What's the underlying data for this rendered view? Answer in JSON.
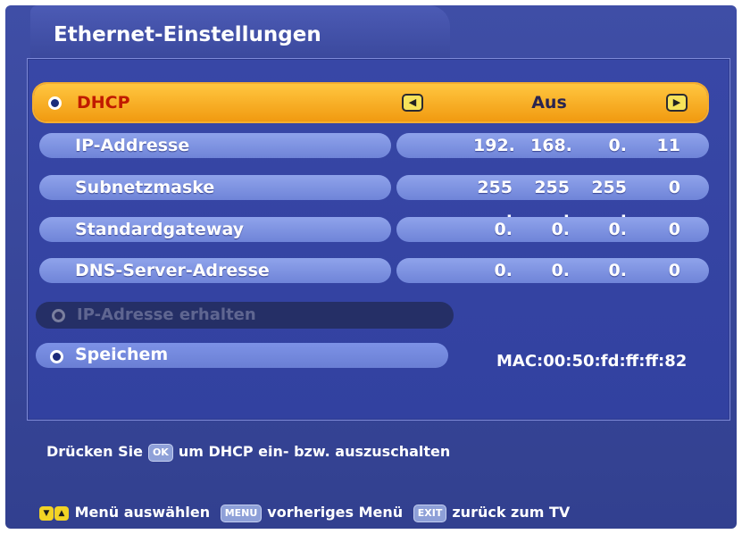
{
  "window": {
    "title": "Ethernet-Einstellungen"
  },
  "dhcp": {
    "label": "DHCP",
    "value": "Aus",
    "left_arrow_icon": "left-arrow-icon",
    "right_arrow_icon": "right-arrow-icon"
  },
  "rows": [
    {
      "label": "IP-Addresse",
      "octets": [
        "192.",
        "168.",
        "0.",
        "11"
      ]
    },
    {
      "label": "Subnetzmaske",
      "octets": [
        "255 .",
        "255 .",
        "255 .",
        "0"
      ]
    },
    {
      "label": "Standardgateway",
      "octets": [
        "0.",
        "0.",
        "0.",
        "0"
      ]
    },
    {
      "label": "DNS-Server-Adresse",
      "octets": [
        "0.",
        "0.",
        "0.",
        "0"
      ]
    }
  ],
  "actions": {
    "obtain_ip_label": "IP-Adresse erhalten",
    "save_label": "Speichem"
  },
  "mac_label": "MAC:00:50:fd:ff:ff:82",
  "hint": {
    "before": "Drücken Sie",
    "key": "OK",
    "after": "um DHCP ein- bzw. auszuschalten"
  },
  "footer": {
    "select_label": "Menü auswählen",
    "menu_key": "MENU",
    "menu_label": "vorheriges Menü",
    "exit_key": "EXIT",
    "exit_label": "zurück zum TV"
  },
  "colors": {
    "background": "#3a489f",
    "highlight": "#f5a623",
    "pill": "#7d92e6"
  }
}
